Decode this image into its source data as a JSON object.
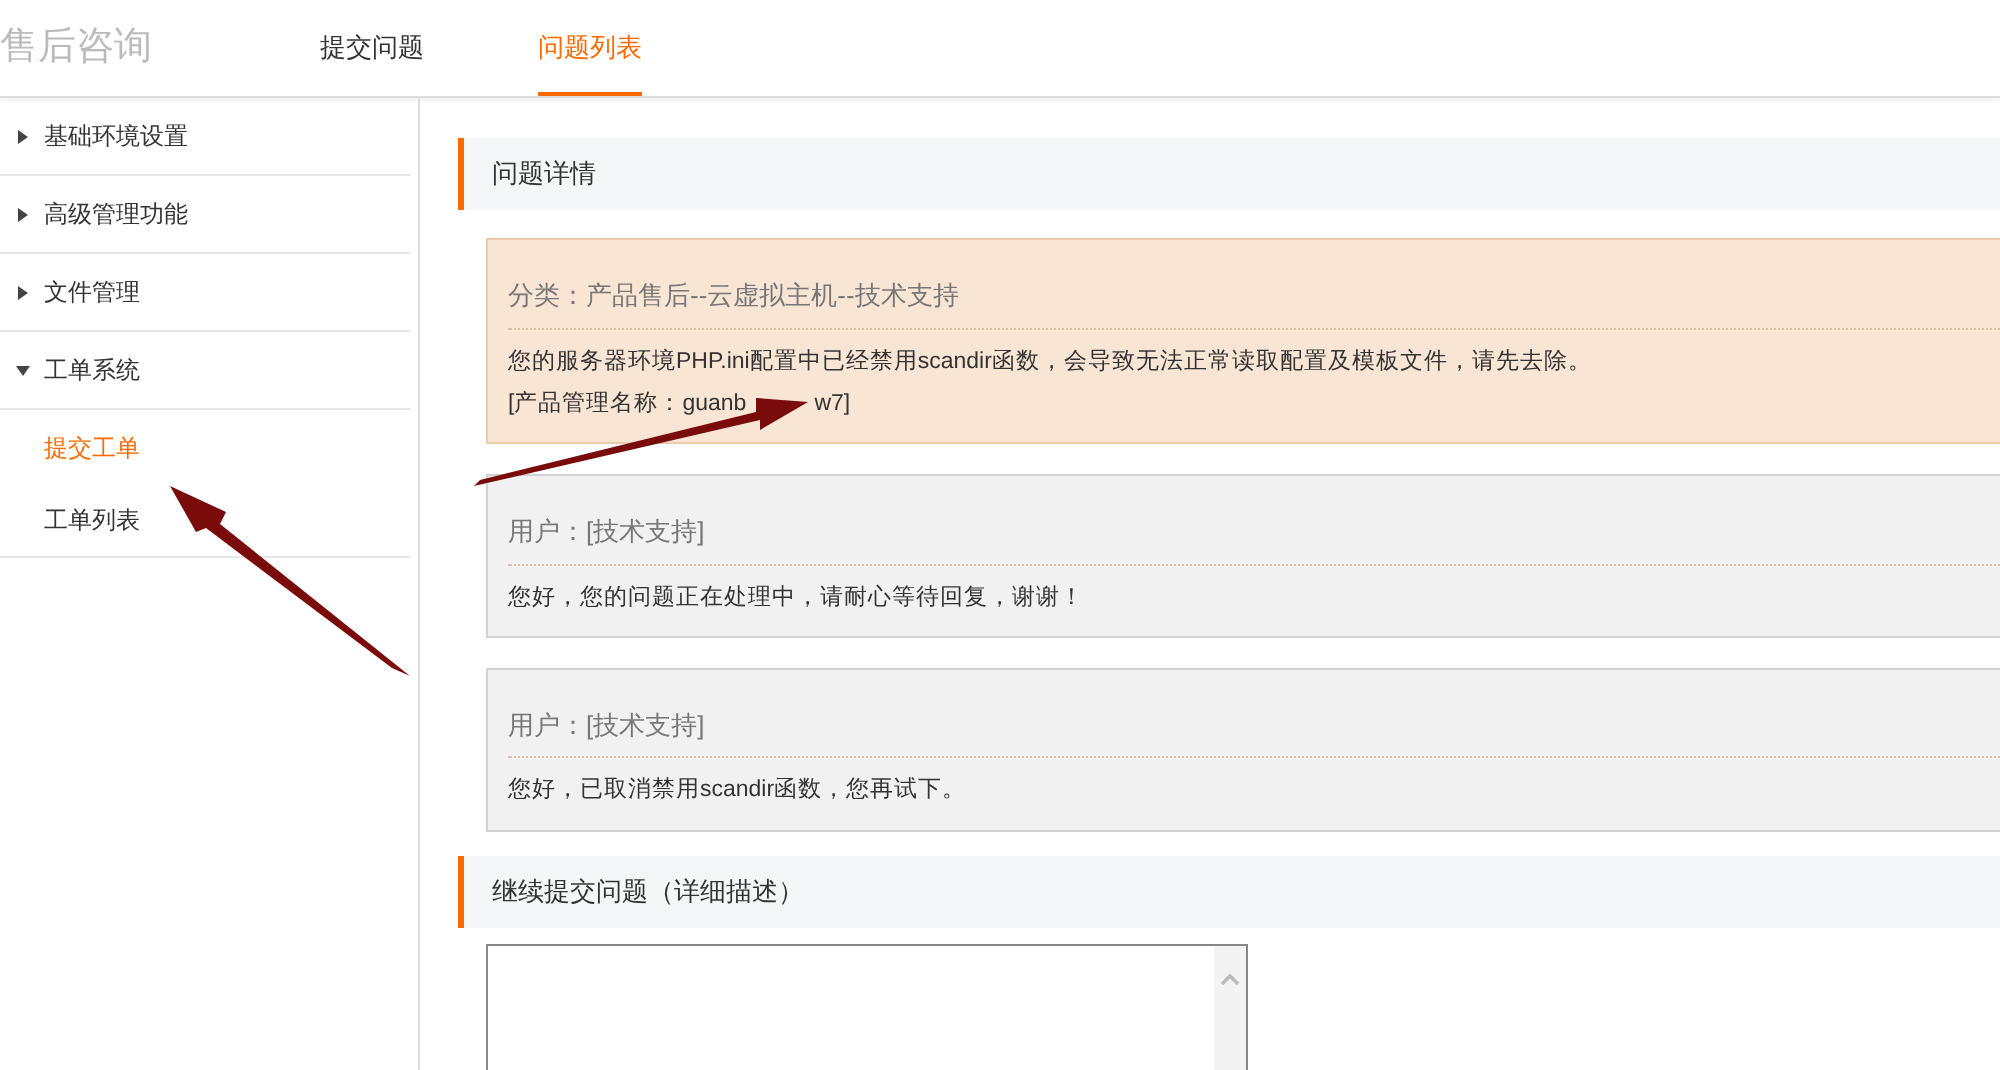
{
  "header": {
    "title": "售后咨询"
  },
  "tabs": [
    {
      "label": "提交问题",
      "selected": false
    },
    {
      "label": "问题列表",
      "selected": true
    }
  ],
  "sidebar": {
    "items": [
      {
        "label": "基础环境设置",
        "expanded": false
      },
      {
        "label": "高级管理功能",
        "expanded": false
      },
      {
        "label": "文件管理",
        "expanded": false
      },
      {
        "label": "工单系统",
        "expanded": true,
        "children": [
          {
            "label": "提交工单",
            "selected": true
          },
          {
            "label": "工单列表",
            "selected": false
          }
        ]
      }
    ]
  },
  "detail": {
    "title": "问题详情",
    "messages": [
      {
        "kind": "notice",
        "heading": "分类：产品售后--云虚拟主机--技术支持",
        "lines": [
          [
            "您的服务器环境PHP.ini配置中已经禁用scandir函数，会导致无法正常读取配置及模板文件，请先去除。"
          ],
          [
            "[产品管理名称：guanb",
            "w7]"
          ]
        ]
      },
      {
        "kind": "reply",
        "heading": "用户：[技术支持]",
        "lines": [
          [
            "您好，您的问题正在处理中，请耐心等待回复，谢谢！"
          ]
        ]
      },
      {
        "kind": "reply",
        "heading": "用户：[技术支持]",
        "lines": [
          [
            "您好，已取消禁用scandir函数，您再试下。"
          ]
        ]
      }
    ]
  },
  "reply_form": {
    "title": "继续提交问题（详细描述）"
  }
}
